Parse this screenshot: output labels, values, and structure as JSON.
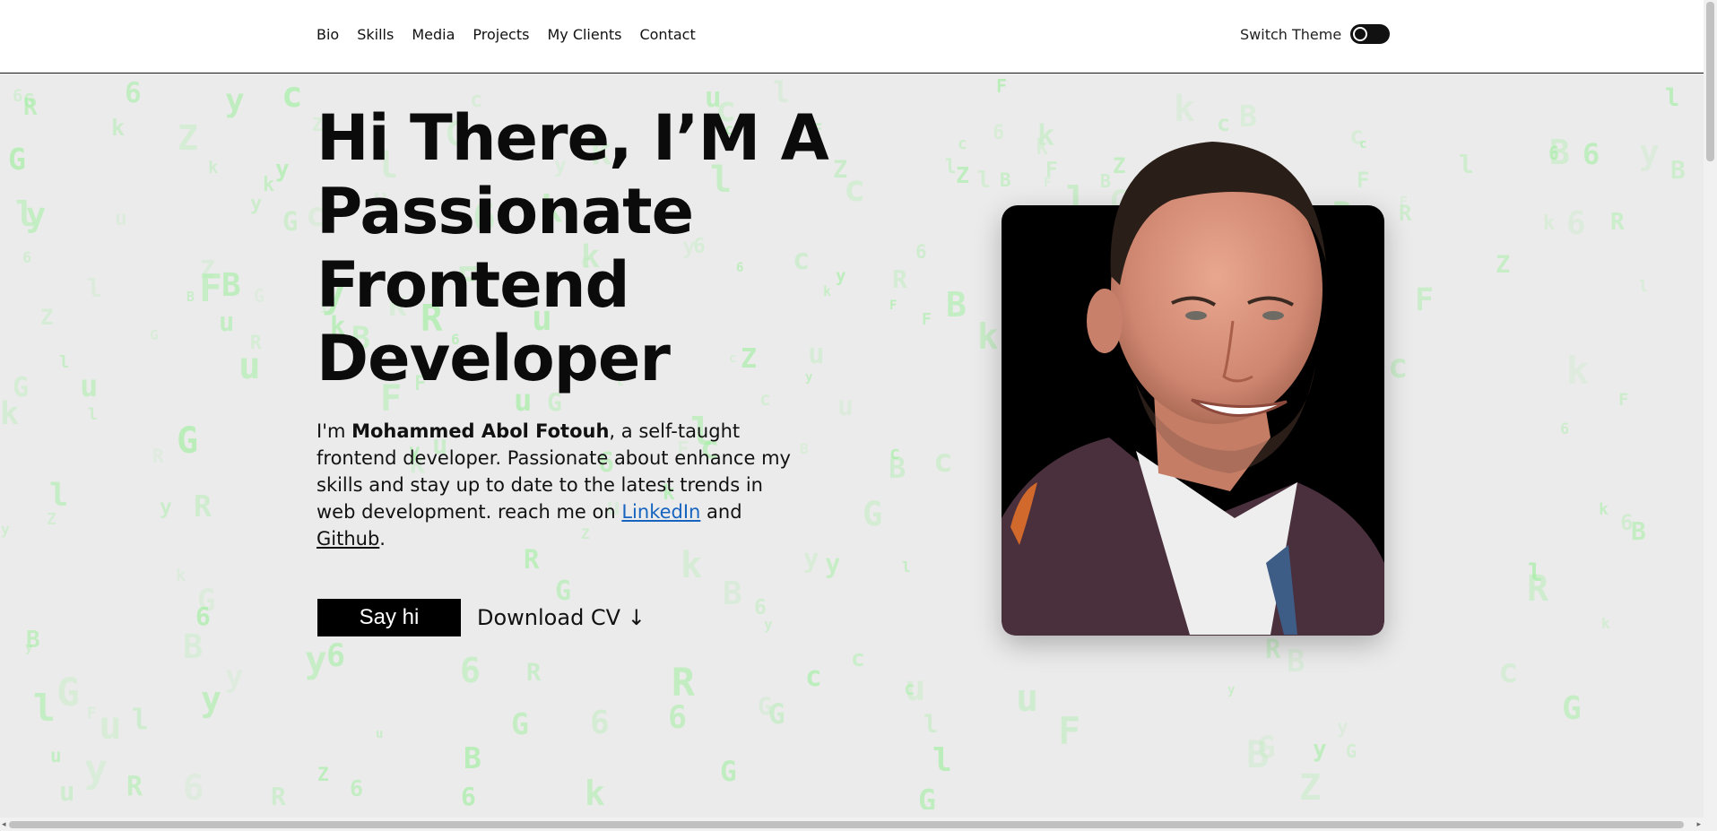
{
  "header": {
    "nav": [
      {
        "label": "Bio"
      },
      {
        "label": "Skills"
      },
      {
        "label": "Media"
      },
      {
        "label": "Projects"
      },
      {
        "label": "My Clients"
      },
      {
        "label": "Contact"
      }
    ],
    "theme_label": "Switch Theme",
    "theme_dark": false
  },
  "hero": {
    "headline_lines": [
      "Hi There, I’M A",
      "Passionate",
      "Frontend",
      "Developer"
    ],
    "intro": {
      "prefix": "I'm ",
      "name": "Mohammed Abol Fotouh",
      "middle": ", a self-taught frontend developer. Passionate about enhance my skills and stay up to date to the latest trends in web development. reach me on ",
      "linkedin": "LinkedIn",
      "and": " and ",
      "github": "Github",
      "suffix": "."
    },
    "say_hi_label": "Say hi",
    "download_label": "Download CV ↓"
  },
  "colors": {
    "background": "#ebebeb",
    "matrix_glyph": "#9af09a",
    "text": "#0b0b0b",
    "link": "#1764c0",
    "button_bg": "#000000"
  }
}
